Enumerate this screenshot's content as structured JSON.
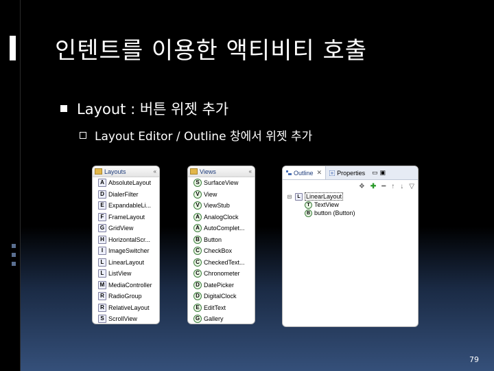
{
  "slide": {
    "title": "인텐트를 이용한 액티비티 호출",
    "bullet1": "Layout : 버튼 위젯 추가",
    "bullet2": "Layout Editor / Outline 창에서 위젯 추가",
    "page_number": "79"
  },
  "layouts_panel": {
    "title": "Layouts",
    "items": [
      {
        "icon": "A",
        "label": "AbsoluteLayout"
      },
      {
        "icon": "D",
        "label": "DialerFilter"
      },
      {
        "icon": "E",
        "label": "ExpandableLi..."
      },
      {
        "icon": "F",
        "label": "FrameLayout"
      },
      {
        "icon": "G",
        "label": "GridView"
      },
      {
        "icon": "H",
        "label": "HorizontalScr..."
      },
      {
        "icon": "I",
        "label": "ImageSwitcher"
      },
      {
        "icon": "L",
        "label": "LinearLayout"
      },
      {
        "icon": "L",
        "label": "ListView"
      },
      {
        "icon": "M",
        "label": "MediaController"
      },
      {
        "icon": "R",
        "label": "RadioGroup"
      },
      {
        "icon": "R",
        "label": "RelativeLayout"
      },
      {
        "icon": "S",
        "label": "ScrollView"
      }
    ]
  },
  "views_panel": {
    "title": "Views",
    "items": [
      {
        "icon": "S",
        "label": "SurfaceView"
      },
      {
        "icon": "V",
        "label": "View"
      },
      {
        "icon": "V",
        "label": "ViewStub"
      },
      {
        "icon": "A",
        "label": "AnalogClock"
      },
      {
        "icon": "A",
        "label": "AutoComplet..."
      },
      {
        "icon": "B",
        "label": "Button"
      },
      {
        "icon": "C",
        "label": "CheckBox"
      },
      {
        "icon": "C",
        "label": "CheckedText..."
      },
      {
        "icon": "C",
        "label": "Chronometer"
      },
      {
        "icon": "D",
        "label": "DatePicker"
      },
      {
        "icon": "D",
        "label": "DigitalClock"
      },
      {
        "icon": "E",
        "label": "EditText"
      },
      {
        "icon": "G",
        "label": "Gallery"
      }
    ]
  },
  "outline_panel": {
    "tab_outline": "Outline",
    "tab_properties": "Properties",
    "tree": [
      {
        "icon": "L",
        "label": "LinearLayout",
        "level": 0
      },
      {
        "icon": "T",
        "label": "TextView",
        "level": 1
      },
      {
        "icon": "B",
        "label": "button (Button)",
        "level": 1
      }
    ]
  },
  "icons": {
    "collapse": "collapse-icon",
    "folder": "folder-icon",
    "close": "close-icon",
    "add": "add-icon",
    "remove": "remove-icon",
    "move_up": "arrow-up-icon",
    "move_down": "arrow-down-icon",
    "view_menu": "view-menu-icon"
  },
  "colors": {
    "background": "#000000",
    "text": "#ffffff",
    "link_blue": "#1b3a7a"
  }
}
